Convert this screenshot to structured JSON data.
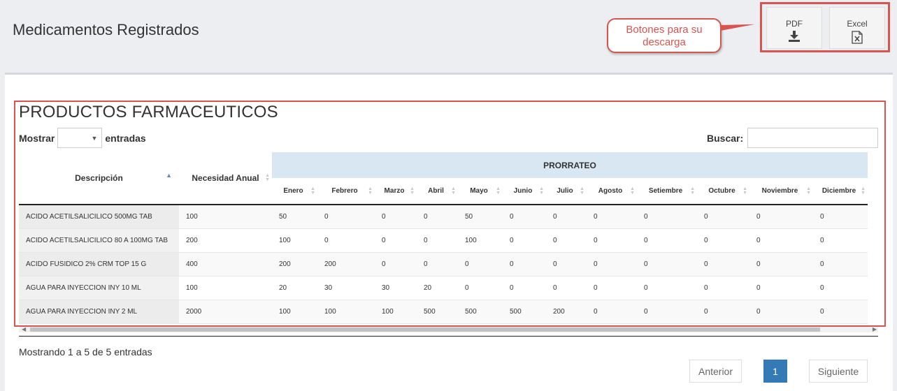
{
  "header": {
    "title": "Medicamentos Registrados"
  },
  "callout": {
    "line1": "Botones para su",
    "line2": "descarga"
  },
  "downloads": {
    "pdf_label": "PDF",
    "excel_label": "Excel"
  },
  "section": {
    "title": "PRODUCTOS FARMACEUTICOS"
  },
  "controls": {
    "show_label": "Mostrar",
    "entries_label": "entradas",
    "search_label": "Buscar:"
  },
  "table": {
    "col_description": "Descripción",
    "col_annual": "Necesidad Anual",
    "group_header": "PRORRATEO",
    "months": [
      "Enero",
      "Febrero",
      "Marzo",
      "Abril",
      "Mayo",
      "Junio",
      "Julio",
      "Agosto",
      "Setiembre",
      "Octubre",
      "Noviembre",
      "Diciembre"
    ],
    "rows": [
      {
        "desc": "ACIDO ACETILSALICILICO 500MG TAB",
        "annual": "100",
        "m": [
          "50",
          "0",
          "0",
          "0",
          "50",
          "0",
          "0",
          "0",
          "0",
          "0",
          "0",
          "0"
        ]
      },
      {
        "desc": "ACIDO ACETILSALICILICO 80 A 100MG TAB",
        "annual": "200",
        "m": [
          "100",
          "0",
          "0",
          "0",
          "100",
          "0",
          "0",
          "0",
          "0",
          "0",
          "0",
          "0"
        ]
      },
      {
        "desc": "ACIDO FUSIDICO 2% CRM TOP 15 G",
        "annual": "400",
        "m": [
          "200",
          "200",
          "0",
          "0",
          "0",
          "0",
          "0",
          "0",
          "0",
          "0",
          "0",
          "0"
        ]
      },
      {
        "desc": "AGUA PARA INYECCION INY 10 ML",
        "annual": "100",
        "m": [
          "20",
          "30",
          "30",
          "20",
          "0",
          "0",
          "0",
          "0",
          "0",
          "0",
          "0",
          "0"
        ]
      },
      {
        "desc": "AGUA PARA INYECCION INY 2 ML",
        "annual": "2000",
        "m": [
          "100",
          "100",
          "100",
          "500",
          "500",
          "500",
          "200",
          "0",
          "0",
          "0",
          "0",
          "0"
        ]
      }
    ]
  },
  "footer": {
    "info": "Mostrando 1 a 5 de 5 entradas"
  },
  "pagination": {
    "prev": "Anterior",
    "page": "1",
    "next": "Siguiente"
  }
}
